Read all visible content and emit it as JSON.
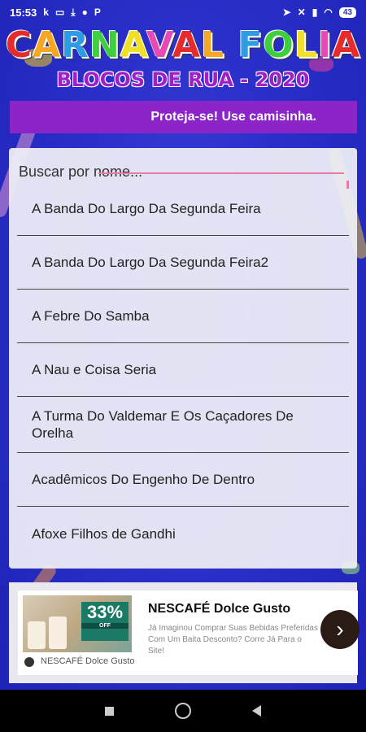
{
  "status_bar": {
    "time": "15:53",
    "left_icons": [
      "k-icon",
      "laptop-icon",
      "download-icon",
      "chat-icon",
      "p-icon"
    ],
    "right_icons": [
      "location-icon",
      "mute-icon",
      "signal-icon",
      "wifi-icon"
    ],
    "battery": "43"
  },
  "header": {
    "title": "CARNAVAL FOLIA",
    "subtitle": "BLOCOS DE RUA - 2020"
  },
  "banner": {
    "text": "Proteja-se! Use camisinha."
  },
  "search": {
    "placeholder": "Buscar por nome..."
  },
  "list": {
    "items": [
      "A Banda Do Largo Da Segunda Feira",
      "A Banda Do Largo Da Segunda Feira2",
      "A Febre Do Samba",
      "A Nau e Coisa Seria",
      "A Turma Do Valdemar E Os Caçadores De Orelha",
      "Acadêmicos Do Engenho De Dentro",
      "Afoxe Filhos de Gandhi"
    ]
  },
  "ad": {
    "offer_percent": "33%",
    "offer_label": "OFF",
    "brand": "NESCAFÉ Dolce Gusto",
    "title": "NESCAFÉ Dolce Gusto",
    "description": "Já Imaginou Comprar Suas Bebidas Preferidas Com Um Baita Desconto? Corre Já Para o Site!",
    "cta_icon": "chevron-right-icon"
  },
  "colors": {
    "background": "#2a2fc9",
    "banner": "#8b25c8",
    "accent_underline": "#e87ca8",
    "title_letters": [
      "#e52b2b",
      "#f5a623",
      "#2e9be5",
      "#3ecf3e",
      "#f0e02a",
      "#e84ab5"
    ]
  }
}
